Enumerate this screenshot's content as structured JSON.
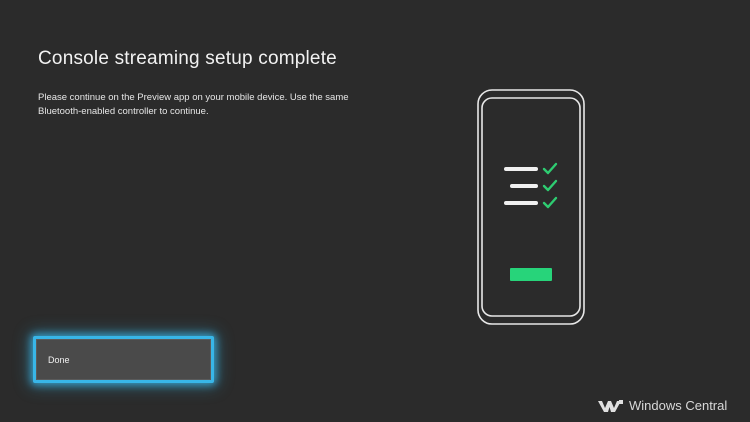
{
  "setup": {
    "title": "Console streaming setup complete",
    "description": "Please continue on the Preview app on your mobile device. Use the same Bluetooth-enabled controller to continue."
  },
  "actions": {
    "done_label": "Done"
  },
  "illustration": {
    "checklist_rows": 3,
    "check_color": "#2ecc71",
    "button_color": "#27d47a"
  },
  "watermark": {
    "text": "Windows Central"
  },
  "colors": {
    "background": "#2b2b2b",
    "focus": "#38b6e8"
  }
}
